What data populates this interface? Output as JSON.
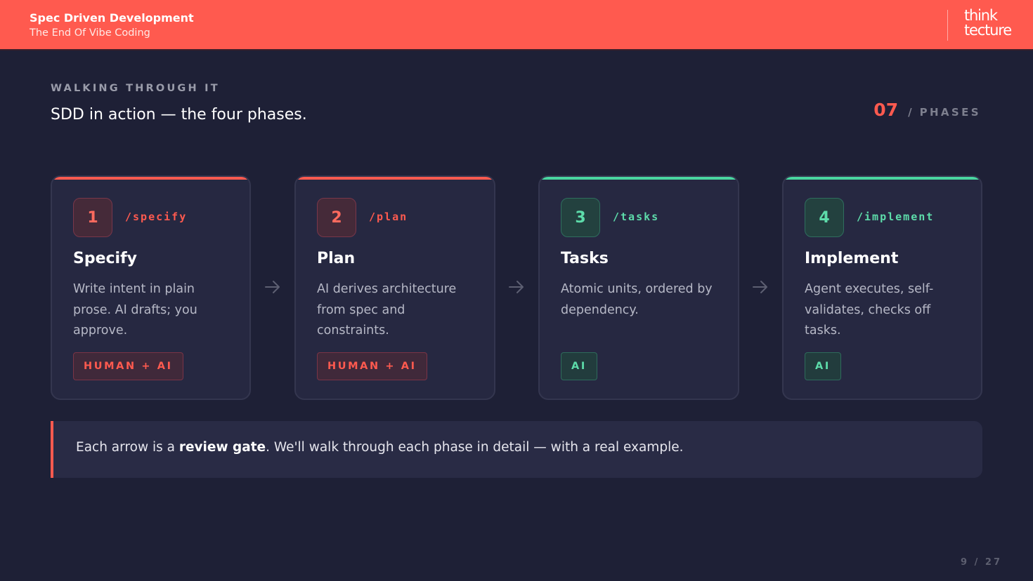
{
  "header": {
    "title": "Spec Driven Development",
    "subtitle": "The End Of Vibe Coding",
    "logo_line1": "think",
    "logo_line2": "tecture"
  },
  "section": {
    "eyebrow": "WALKING THROUGH IT",
    "heading": "SDD in action — the four phases.",
    "counter_number": "07",
    "counter_sep": "/",
    "counter_label": "PHASES"
  },
  "phases": [
    {
      "number": "1",
      "command": "/specify",
      "name": "Specify",
      "description": "Write intent in plain prose. AI drafts; you approve.",
      "tag": "HUMAN + AI"
    },
    {
      "number": "2",
      "command": "/plan",
      "name": "Plan",
      "description": "AI derives architecture from spec and constraints.",
      "tag": "HUMAN + AI"
    },
    {
      "number": "3",
      "command": "/tasks",
      "name": "Tasks",
      "description": "Atomic units, ordered by dependency.",
      "tag": "AI"
    },
    {
      "number": "4",
      "command": "/implement",
      "name": "Implement",
      "description": "Agent executes, self-validates, checks off tasks.",
      "tag": "AI"
    }
  ],
  "callout": {
    "before": "Each arrow is a ",
    "bold": "review gate",
    "after": ". We'll walk through each phase in detail — with a real example."
  },
  "pager": {
    "current": "9",
    "sep": "/",
    "total": "27"
  },
  "colors": {
    "accent": "#ff5a4f",
    "human_ai": "#ff5a4f",
    "ai": "#5ddcaa",
    "background": "#1e2036"
  },
  "icons": {
    "arrow": "arrow-right-icon"
  }
}
